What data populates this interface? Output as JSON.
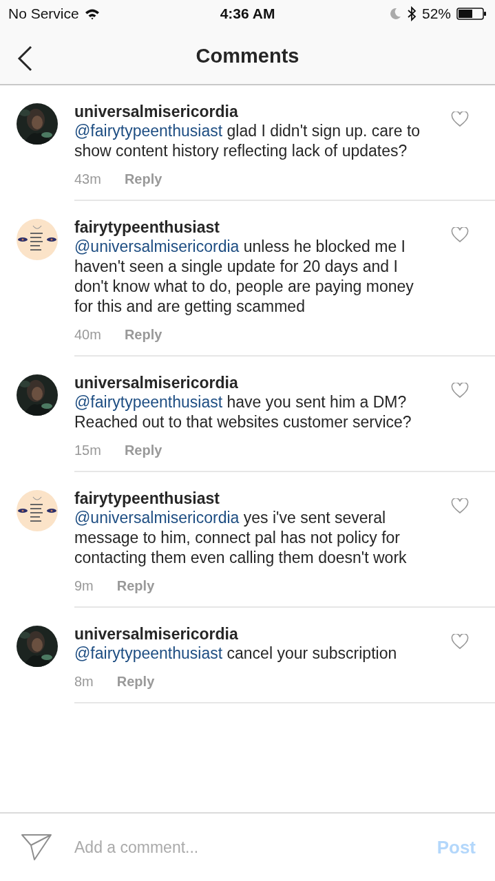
{
  "status_bar": {
    "carrier": "No Service",
    "time": "4:36 AM",
    "battery": "52%"
  },
  "nav": {
    "title": "Comments"
  },
  "comments": [
    {
      "username": "universalmisericordia",
      "mention": "@fairytypeenthusiast",
      "text": "glad I didn't sign up. care to show content history reflecting lack of updates?",
      "time": "43m",
      "reply": "Reply",
      "liked": false
    },
    {
      "username": "fairytypeenthusiast",
      "mention": "@universalmisericordia",
      "text": "unless he blocked me I haven't seen a single update for 20 days and I don't know what to do, people are paying money for this and are getting scammed",
      "time": "40m",
      "reply": "Reply",
      "liked": false
    },
    {
      "username": "universalmisericordia",
      "mention": "@fairytypeenthusiast",
      "text": "have you sent him a DM? Reached out to that websites customer service?",
      "time": "15m",
      "reply": "Reply",
      "liked": false
    },
    {
      "username": "fairytypeenthusiast",
      "mention": "@universalmisericordia",
      "text": "yes i've sent several message to him, connect pal has not policy for contacting them even calling them doesn't work",
      "time": "9m",
      "reply": "Reply",
      "liked": false
    },
    {
      "username": "universalmisericordia",
      "mention": "@fairytypeenthusiast",
      "text": "cancel your subscription",
      "time": "8m",
      "reply": "Reply",
      "liked": false
    }
  ],
  "composer": {
    "placeholder": "Add a comment...",
    "post": "Post",
    "post_enabled": false
  }
}
